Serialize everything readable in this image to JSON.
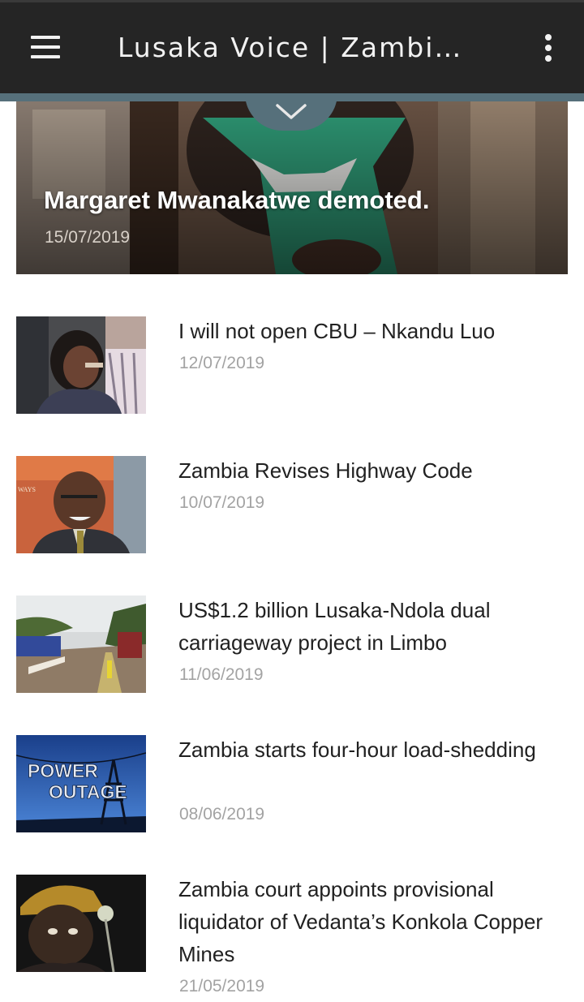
{
  "app": {
    "title": "Lusaka Voice | Zambia's News Source"
  },
  "colors": {
    "appbar": "#252525",
    "accent": "#56707b",
    "title_text": "#212121",
    "date_text": "#a3a3a3"
  },
  "icons": {
    "menu": "hamburger-menu-icon",
    "more": "more-vert-icon",
    "collapse": "chevron-down-icon"
  },
  "featured": {
    "title": "Margaret Mwanakatwe demoted.",
    "date": "15/07/2019"
  },
  "articles": [
    {
      "title": "I will not open CBU – Nkandu Luo",
      "date": "12/07/2019"
    },
    {
      "title": "Zambia Revises Highway Code",
      "date": "10/07/2019"
    },
    {
      "title": "US$1.2 billion Lusaka-Ndola dual carriageway project in Limbo",
      "date": "11/06/2019"
    },
    {
      "title": "Zambia starts four-hour load-shedding",
      "date": "08/06/2019"
    },
    {
      "title": "Zambia court appoints provisional liquidator of Vedanta’s Konkola Copper Mines",
      "date": "21/05/2019"
    }
  ],
  "thumb_texts": {
    "banner_sign": "WAYS",
    "power_line1": "POWER",
    "power_line2": "OUTAGE"
  }
}
